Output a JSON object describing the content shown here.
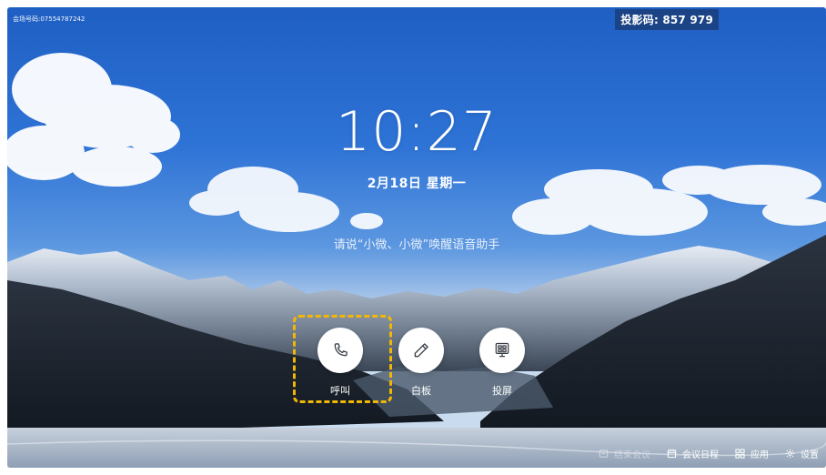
{
  "header": {
    "meeting_id": "会场号码:07554787242",
    "cast_code": "投影码: 857 979"
  },
  "home": {
    "time": "10:27",
    "date": "2月18日 星期一",
    "voice_hint": "请说“小微、小微”唤醒语音助手"
  },
  "actions": [
    {
      "label": "呼叫",
      "icon": "phone-icon"
    },
    {
      "label": "白板",
      "icon": "pen-icon"
    },
    {
      "label": "投屏",
      "icon": "screen-share-icon"
    }
  ],
  "bottom_bar": [
    {
      "label": "结束会议",
      "icon": "end-meeting-icon"
    },
    {
      "label": "会议日程",
      "icon": "calendar-icon"
    },
    {
      "label": "应用",
      "icon": "apps-icon"
    },
    {
      "label": "设置",
      "icon": "settings-icon"
    }
  ],
  "colors": {
    "highlight": "#f2b705",
    "sky": "#2e73d6"
  }
}
